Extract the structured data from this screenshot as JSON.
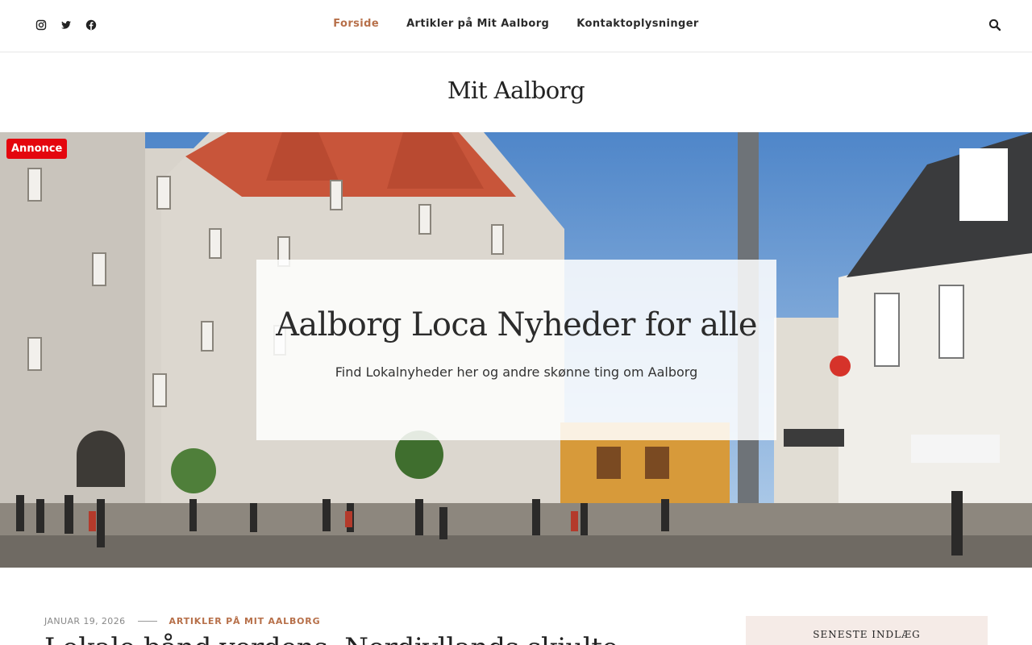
{
  "social": {
    "icons": [
      "instagram-icon",
      "twitter-icon",
      "facebook-icon"
    ]
  },
  "nav": {
    "items": [
      {
        "label": "Forside",
        "active": true
      },
      {
        "label": "Artikler på Mit Aalborg",
        "active": false
      },
      {
        "label": "Kontaktoplysninger",
        "active": false
      }
    ],
    "search_icon": "search-icon"
  },
  "site": {
    "title": "Mit Aalborg"
  },
  "hero": {
    "badge": "Annonce",
    "heading": "Aalborg Loca Nyheder for alle",
    "subheading": "Find Lokalnyheder her og andre skønne ting om Aalborg"
  },
  "post": {
    "date": "JANUAR 19, 2026",
    "category": "ARTIKLER PÅ MIT AALBORG",
    "title": "Lokale bånd verdens, Nordjyllands skjulte"
  },
  "sidebar": {
    "widget_title": "SENESTE INDLÆG"
  },
  "colors": {
    "accent": "#b7704a",
    "badge": "#e4060e",
    "widget_bg": "#f5ebe7"
  }
}
